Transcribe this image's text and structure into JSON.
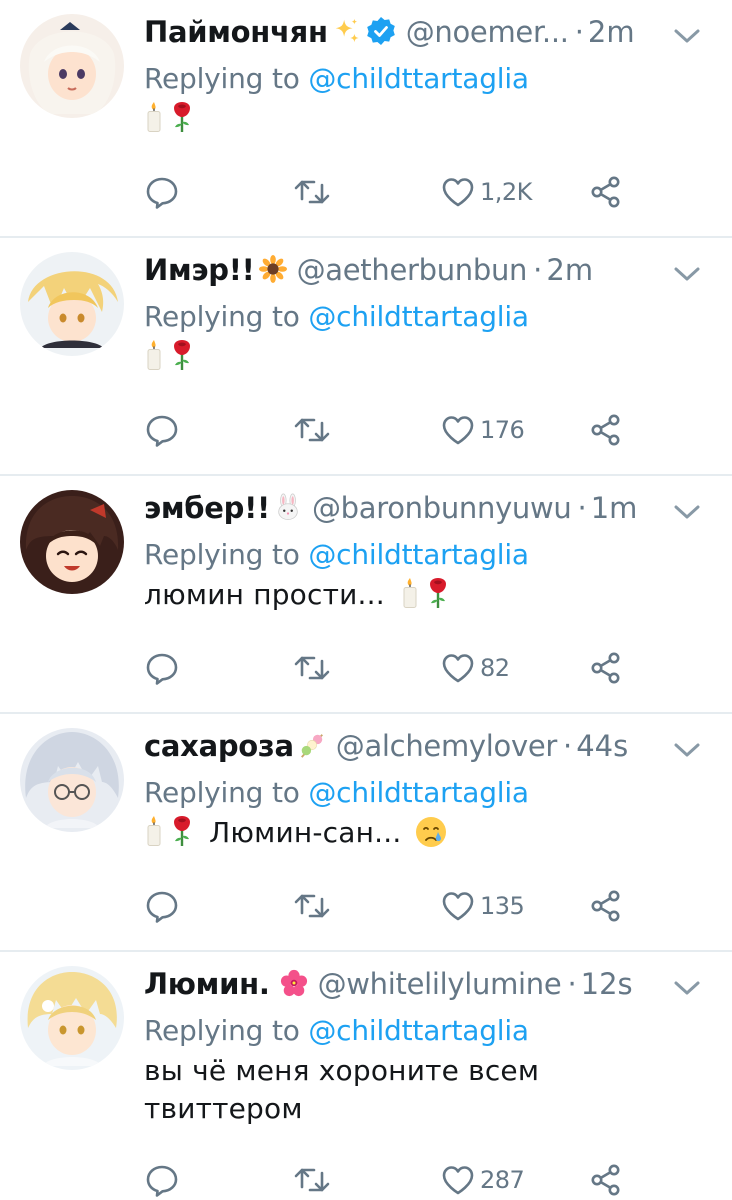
{
  "tweets": [
    {
      "name": "Паймончян",
      "name_emoji": "sparkles-emoji",
      "verified": true,
      "handle": "@noemer...",
      "time": "2m",
      "reply_prefix": "Replying to",
      "mention": "@childttartaglia",
      "text_before": "",
      "text_after": "",
      "text_lines": [],
      "icons": [
        "candle-emoji",
        "rose-emoji"
      ],
      "likes": "1,2K"
    },
    {
      "name": "Имэр!!",
      "name_emoji": "sunflower-emoji",
      "verified": false,
      "handle": "@aetherbunbun",
      "time": "2m",
      "reply_prefix": "Replying to",
      "mention": "@childttartaglia",
      "icons": [
        "candle-emoji",
        "rose-emoji"
      ],
      "likes": "176"
    },
    {
      "name": "эмбер!!",
      "name_emoji": "rabbit-face-emoji",
      "verified": false,
      "handle": "@baronbunnyuwu",
      "time": "1m",
      "reply_prefix": "Replying to",
      "mention": "@childttartaglia",
      "text": "люмин прости...",
      "icons": [
        "candle-emoji",
        "rose-emoji"
      ],
      "likes": "82"
    },
    {
      "name": "сахароза",
      "name_emoji": "dango-emoji",
      "verified": false,
      "handle": "@alchemylover",
      "time": "44s",
      "reply_prefix": "Replying to",
      "mention": "@childttartaglia",
      "text": "Люмин-сан...",
      "icons": [
        "candle-emoji",
        "rose-emoji",
        "crying-face-emoji"
      ],
      "likes": "135"
    },
    {
      "name": "Люмин.",
      "name_emoji": "hibiscus-emoji",
      "verified": false,
      "handle": "@whitelilylumine",
      "time": "12s",
      "reply_prefix": "Replying to",
      "mention": "@childttartaglia",
      "text_line1": "вы чё меня хороните всем",
      "text_line2": "твиттером",
      "likes": "287"
    }
  ],
  "colors": {
    "text": "#14171a",
    "secondary": "#657786",
    "link": "#1da1f2",
    "separator": "#e6ecf0"
  },
  "action_icons": [
    "reply-icon",
    "retweet-icon",
    "like-icon",
    "share-icon"
  ]
}
